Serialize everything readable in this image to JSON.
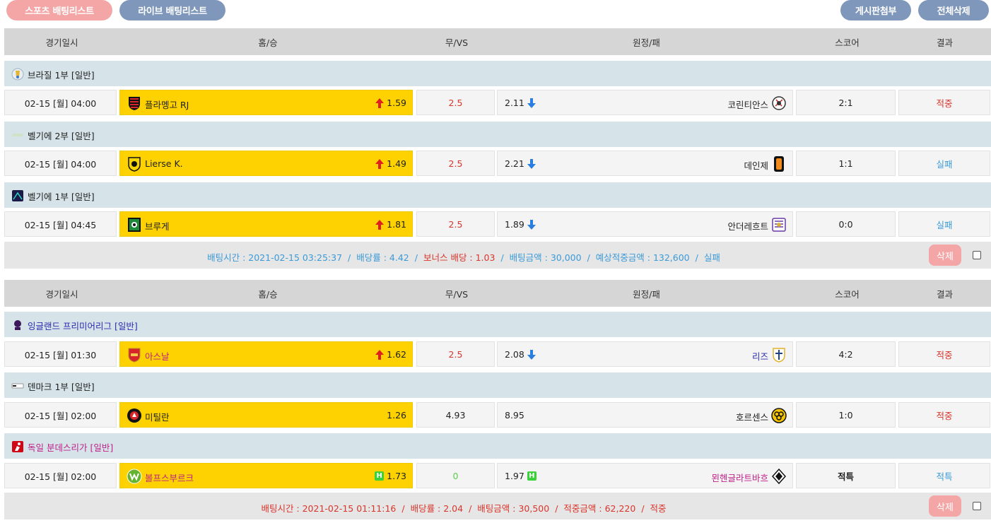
{
  "top": {
    "btn_sports": "스포츠 배팅리스트",
    "btn_live": "라이브 배팅리스트",
    "btn_attach": "게시판첨부",
    "btn_delete_all": "전체삭제",
    "colors": {
      "sports": "#f4a6a6",
      "live": "#7f97ba",
      "attach": "#7f97ba",
      "delete_all": "#7f97ba"
    }
  },
  "header": {
    "date": "경기일시",
    "home": "홈/승",
    "draw": "무/VS",
    "away": "원정/패",
    "score": "스코어",
    "result": "결과"
  },
  "bets": [
    {
      "leagues": [
        {
          "name": "브라질 1부 [일반]",
          "name_color": "#222222",
          "icon": "brazil-league-icon",
          "match": {
            "date": "02-15 [월] 04:00",
            "home": "플라멩고 RJ",
            "home_color": "#222222",
            "home_logo": "flamengo-logo-icon",
            "home_odds": "1.59",
            "home_marker": "up",
            "draw": "2.5",
            "draw_color": "#d9352b",
            "away_odds": "2.11",
            "away_marker": "down",
            "away": "코린티안스",
            "away_color": "#222222",
            "away_logo": "corinthians-logo-icon",
            "score": "2:1",
            "result": "적중",
            "result_color": "#d9352b"
          }
        },
        {
          "name": "벨기에 2부 [일반]",
          "name_color": "#222222",
          "icon": "belgium-league-icon",
          "match": {
            "date": "02-15 [월] 04:00",
            "home": "Lierse K.",
            "home_color": "#222222",
            "home_logo": "lierse-logo-icon",
            "home_odds": "1.49",
            "home_marker": "up",
            "draw": "2.5",
            "draw_color": "#d9352b",
            "away_odds": "2.21",
            "away_marker": "down",
            "away": "데인제",
            "away_color": "#222222",
            "away_logo": "deinze-logo-icon",
            "score": "1:1",
            "result": "실패",
            "result_color": "#3a9ad9"
          }
        },
        {
          "name": "벨기에 1부 [일반]",
          "name_color": "#222222",
          "icon": "jupiler-league-icon",
          "match": {
            "date": "02-15 [월] 04:45",
            "home": "브루게",
            "home_color": "#222222",
            "home_logo": "brugge-logo-icon",
            "home_odds": "1.81",
            "home_marker": "up",
            "draw": "2.5",
            "draw_color": "#d9352b",
            "away_odds": "1.89",
            "away_marker": "down",
            "away": "안더레흐트",
            "away_color": "#222222",
            "away_logo": "anderlecht-logo-icon",
            "score": "0:0",
            "result": "실패",
            "result_color": "#3a9ad9"
          }
        }
      ],
      "summary": {
        "color": "#3a9ad9",
        "time": "배팅시간 : 2021-02-15 03:25:37",
        "rate": "배당률 : 4.42",
        "bonus": "보너스 배당 : 1.03",
        "bonus_color": "#d9352b",
        "amount": "배팅금액 : 30,000",
        "expected": "예상적중금액 : 132,600",
        "status": "실패",
        "delete": "삭제"
      }
    },
    {
      "leagues": [
        {
          "name": "잉글랜드 프리미어리그 [일반]",
          "name_color": "#2b2bb0",
          "icon": "premier-league-icon",
          "match": {
            "date": "02-15 [월] 01:30",
            "home": "아스날",
            "home_color": "#c0208a",
            "home_logo": "arsenal-logo-icon",
            "home_odds": "1.62",
            "home_marker": "up",
            "draw": "2.5",
            "draw_color": "#d9352b",
            "away_odds": "2.08",
            "away_marker": "down",
            "away": "리즈",
            "away_color": "#2b2bb0",
            "away_logo": "leeds-logo-icon",
            "score": "4:2",
            "result": "적중",
            "result_color": "#d9352b"
          }
        },
        {
          "name": "덴마크 1부 [일반]",
          "name_color": "#222222",
          "icon": "denmark-league-icon",
          "match": {
            "date": "02-15 [월] 02:00",
            "home": "미틸란",
            "home_color": "#222222",
            "home_logo": "midtjylland-logo-icon",
            "home_odds": "1.26",
            "home_marker": "",
            "draw": "4.93",
            "draw_color": "#222222",
            "away_odds": "8.95",
            "away_marker": "",
            "away": "호르센스",
            "away_color": "#222222",
            "away_logo": "horsens-logo-icon",
            "score": "1:0",
            "result": "적중",
            "result_color": "#d9352b"
          }
        },
        {
          "name": "독일 분데스리가 [일반]",
          "name_color": "#c0208a",
          "icon": "bundesliga-icon",
          "match": {
            "date": "02-15 [월] 02:00",
            "home": "볼프스부르크",
            "home_color": "#c0208a",
            "home_logo": "wolfsburg-logo-icon",
            "home_odds": "1.73",
            "home_marker": "H",
            "draw": "0",
            "draw_color": "#5ad04a",
            "away_odds": "1.97",
            "away_marker": "H",
            "away": "묀헨글라트바흐",
            "away_color": "#c0208a",
            "away_logo": "gladbach-logo-icon",
            "score": "적특",
            "result": "적특",
            "result_color": "#3a9ad9"
          }
        }
      ],
      "summary": {
        "color": "#d9352b",
        "time": "배팅시간 : 2021-02-15 01:11:16",
        "rate": "배당률 : 2.04",
        "bonus": "",
        "bonus_color": "#d9352b",
        "amount": "배팅금액 : 30,500",
        "expected": "적중금액 : 62,220",
        "status": "적중",
        "delete": "삭제"
      }
    }
  ]
}
